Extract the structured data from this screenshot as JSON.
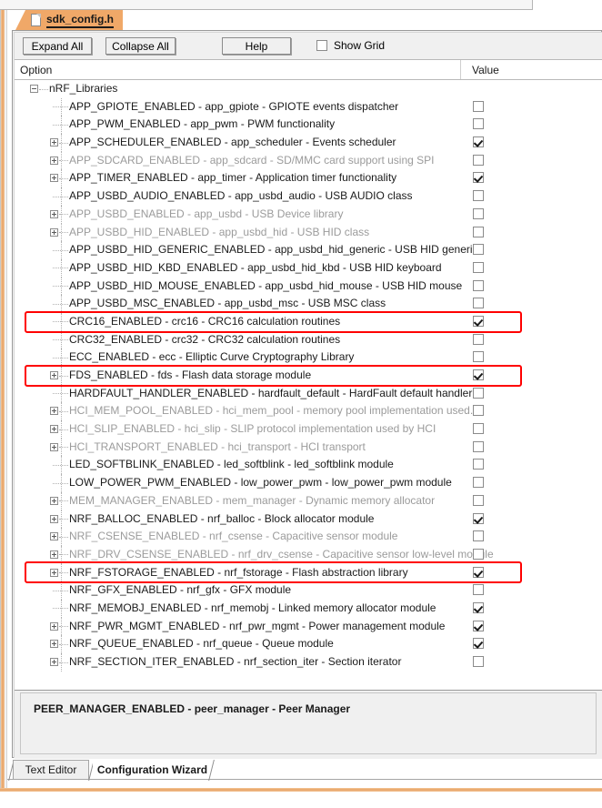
{
  "document_tab": {
    "label": "sdk_config.h",
    "icon": "file-icon",
    "color": "#f0a868"
  },
  "toolbar": {
    "expand_all_label": "Expand All",
    "collapse_all_label": "Collapse All",
    "help_label": "Help",
    "show_grid_label": "Show Grid",
    "show_grid_checked": false
  },
  "grid": {
    "columns": [
      "Option",
      "Value"
    ],
    "rows": [
      {
        "indent": "root",
        "expander": "minus",
        "label": "nRF_Libraries",
        "disabled": false,
        "checkbox": null
      },
      {
        "indent": "child",
        "expander": "none",
        "label": "APP_GPIOTE_ENABLED  - app_gpiote - GPIOTE events dispatcher",
        "disabled": false,
        "checkbox": false
      },
      {
        "indent": "child",
        "expander": "none",
        "label": "APP_PWM_ENABLED  - app_pwm - PWM functionality",
        "disabled": false,
        "checkbox": false
      },
      {
        "indent": "child",
        "expander": "plus",
        "label": "APP_SCHEDULER_ENABLED - app_scheduler - Events scheduler",
        "disabled": false,
        "checkbox": true
      },
      {
        "indent": "child",
        "expander": "plus",
        "label": "APP_SDCARD_ENABLED - app_sdcard - SD/MMC card support using SPI",
        "disabled": true,
        "checkbox": false
      },
      {
        "indent": "child",
        "expander": "plus",
        "label": "APP_TIMER_ENABLED - app_timer - Application timer functionality",
        "disabled": false,
        "checkbox": true
      },
      {
        "indent": "child",
        "expander": "none",
        "label": "APP_USBD_AUDIO_ENABLED  - app_usbd_audio - USB AUDIO class",
        "disabled": false,
        "checkbox": false
      },
      {
        "indent": "child",
        "expander": "plus",
        "label": "APP_USBD_ENABLED - app_usbd - USB Device library",
        "disabled": true,
        "checkbox": false
      },
      {
        "indent": "child",
        "expander": "plus",
        "label": "APP_USBD_HID_ENABLED - app_usbd_hid - USB HID class",
        "disabled": true,
        "checkbox": false
      },
      {
        "indent": "child",
        "expander": "none",
        "label": "APP_USBD_HID_GENERIC_ENABLED  - app_usbd_hid_generic - USB HID generic",
        "disabled": false,
        "checkbox": false
      },
      {
        "indent": "child",
        "expander": "none",
        "label": "APP_USBD_HID_KBD_ENABLED  - app_usbd_hid_kbd - USB HID keyboard",
        "disabled": false,
        "checkbox": false
      },
      {
        "indent": "child",
        "expander": "none",
        "label": "APP_USBD_HID_MOUSE_ENABLED  - app_usbd_hid_mouse - USB HID mouse",
        "disabled": false,
        "checkbox": false
      },
      {
        "indent": "child",
        "expander": "none",
        "label": "APP_USBD_MSC_ENABLED  - app_usbd_msc - USB MSC class",
        "disabled": false,
        "checkbox": false
      },
      {
        "indent": "child",
        "expander": "none",
        "label": "CRC16_ENABLED  - crc16 - CRC16 calculation routines",
        "disabled": false,
        "checkbox": true
      },
      {
        "indent": "child",
        "expander": "none",
        "label": "CRC32_ENABLED  - crc32 - CRC32 calculation routines",
        "disabled": false,
        "checkbox": false
      },
      {
        "indent": "child",
        "expander": "none",
        "label": "ECC_ENABLED  - ecc - Elliptic Curve Cryptography Library",
        "disabled": false,
        "checkbox": false
      },
      {
        "indent": "child",
        "expander": "plus",
        "label": "FDS_ENABLED - fds - Flash data storage module",
        "disabled": false,
        "checkbox": true
      },
      {
        "indent": "child",
        "expander": "none",
        "label": "HARDFAULT_HANDLER_ENABLED  - hardfault_default - HardFault default handler ...",
        "disabled": false,
        "checkbox": false
      },
      {
        "indent": "child",
        "expander": "plus",
        "label": "HCI_MEM_POOL_ENABLED - hci_mem_pool - memory pool implementation used...",
        "disabled": true,
        "checkbox": false
      },
      {
        "indent": "child",
        "expander": "plus",
        "label": "HCI_SLIP_ENABLED - hci_slip - SLIP protocol implementation used by HCI",
        "disabled": true,
        "checkbox": false
      },
      {
        "indent": "child",
        "expander": "plus",
        "label": "HCI_TRANSPORT_ENABLED - hci_transport - HCI transport",
        "disabled": true,
        "checkbox": false
      },
      {
        "indent": "child",
        "expander": "none",
        "label": "LED_SOFTBLINK_ENABLED  - led_softblink - led_softblink module",
        "disabled": false,
        "checkbox": false
      },
      {
        "indent": "child",
        "expander": "none",
        "label": "LOW_POWER_PWM_ENABLED  - low_power_pwm - low_power_pwm module",
        "disabled": false,
        "checkbox": false
      },
      {
        "indent": "child",
        "expander": "plus",
        "label": "MEM_MANAGER_ENABLED - mem_manager - Dynamic memory allocator",
        "disabled": true,
        "checkbox": false
      },
      {
        "indent": "child",
        "expander": "plus",
        "label": "NRF_BALLOC_ENABLED - nrf_balloc - Block allocator module",
        "disabled": false,
        "checkbox": true
      },
      {
        "indent": "child",
        "expander": "plus",
        "label": "NRF_CSENSE_ENABLED - nrf_csense - Capacitive sensor module",
        "disabled": true,
        "checkbox": false
      },
      {
        "indent": "child",
        "expander": "plus",
        "label": "NRF_DRV_CSENSE_ENABLED - nrf_drv_csense - Capacitive sensor low-level module",
        "disabled": true,
        "checkbox": false
      },
      {
        "indent": "child",
        "expander": "plus",
        "label": "NRF_FSTORAGE_ENABLED - nrf_fstorage - Flash abstraction library",
        "disabled": false,
        "checkbox": true
      },
      {
        "indent": "child",
        "expander": "none",
        "label": "NRF_GFX_ENABLED  - nrf_gfx - GFX module",
        "disabled": false,
        "checkbox": false
      },
      {
        "indent": "child",
        "expander": "none",
        "label": "NRF_MEMOBJ_ENABLED  - nrf_memobj - Linked memory allocator module",
        "disabled": false,
        "checkbox": true
      },
      {
        "indent": "child",
        "expander": "plus",
        "label": "NRF_PWR_MGMT_ENABLED - nrf_pwr_mgmt - Power management module",
        "disabled": false,
        "checkbox": true
      },
      {
        "indent": "child",
        "expander": "plus",
        "label": "NRF_QUEUE_ENABLED - nrf_queue - Queue module",
        "disabled": false,
        "checkbox": true
      },
      {
        "indent": "child",
        "expander": "plus",
        "label": "NRF_SECTION_ITER_ENABLED - nrf_section_iter - Section iterator",
        "disabled": false,
        "checkbox": false
      }
    ]
  },
  "highlights": {
    "color": "#ff0000",
    "boxes": [
      {
        "row_index": 13,
        "label": "CRC16_ENABLED"
      },
      {
        "row_index": 16,
        "label": "FDS_ENABLED"
      },
      {
        "row_index": 27,
        "label": "NRF_FSTORAGE_ENABLED"
      }
    ]
  },
  "detail_panel": {
    "text": "PEER_MANAGER_ENABLED - peer_manager - Peer Manager"
  },
  "bottom_tabs": {
    "text_editor_label": "Text Editor",
    "configuration_wizard_label": "Configuration Wizard",
    "active": "Configuration Wizard"
  }
}
